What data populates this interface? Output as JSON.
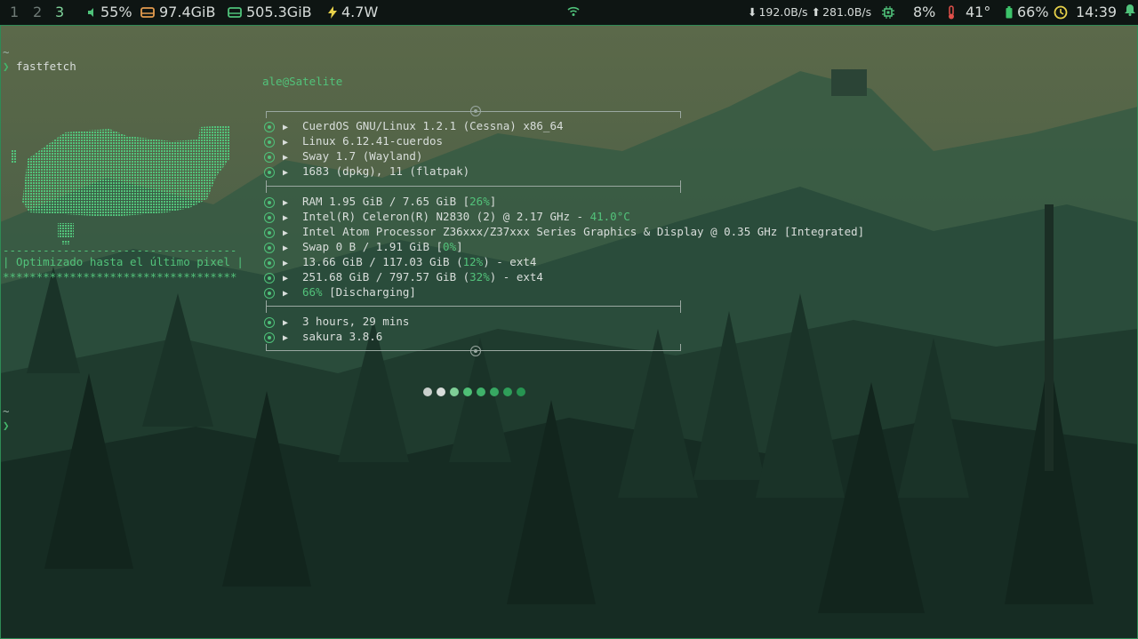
{
  "bar": {
    "workspaces": [
      "1",
      "2",
      "3"
    ],
    "active_workspace": "3",
    "volume": "55%",
    "disk1": "97.4GiB",
    "disk2": "505.3GiB",
    "power": "4.7W",
    "net_down": "192.0B/s",
    "net_up": "281.0B/s",
    "cpu": "8%",
    "temp": "41°",
    "battery": "66%",
    "clock": "14:39",
    "colors": {
      "accent": "#4fc27a",
      "disk1": "#e39b4e",
      "temp": "#e0504a",
      "battery": "#3cc36a",
      "clock": "#e8d24a"
    }
  },
  "terminal": {
    "prompt1_tilde": "~",
    "prompt1_symbol": "❯",
    "command": "fastfetch",
    "prompt2_tilde": "~",
    "prompt2_symbol": "❯",
    "user_host": "ale@Satelite",
    "banner_top": "-----------------------------------",
    "banner_text": "| Optimizado hasta el último pixel |",
    "banner_bottom": "***********************************",
    "groups": [
      [
        {
          "icon": "os-icon",
          "text": "CuerdOS GNU/Linux 1.2.1 (Cessna) x86_64"
        },
        {
          "icon": "kernel-icon",
          "text": "Linux 6.12.41-cuerdos"
        },
        {
          "icon": "wm-icon",
          "text": "Sway 1.7 (Wayland)"
        },
        {
          "icon": "packages-icon",
          "text": "1683 (dpkg), 11 (flatpak)"
        }
      ],
      [
        {
          "icon": "memory-icon",
          "pre": "RAM 1.95 GiB / 7.65 GiB [",
          "hl": "26%",
          "post": "]"
        },
        {
          "icon": "cpu-icon",
          "pre": "Intel(R) Celeron(R) N2830 (2) @ 2.17 GHz - ",
          "hl": "41.0°C",
          "post": ""
        },
        {
          "icon": "gpu-icon",
          "pre": "Intel Atom Processor Z36xxx/Z37xxx Series Graphics & Display @ 0.35 GHz [Integrated]",
          "hl": "",
          "post": ""
        },
        {
          "icon": "swap-icon",
          "pre": "Swap 0 B / 1.91 GiB [",
          "hl": "0%",
          "post": "]"
        },
        {
          "icon": "disk-icon",
          "pre": "13.66 GiB / 117.03 GiB (",
          "hl": "12%",
          "post": ") - ext4"
        },
        {
          "icon": "disk-icon",
          "pre": "251.68 GiB / 797.57 GiB (",
          "hl": "32%",
          "post": ") - ext4"
        },
        {
          "icon": "battery-icon",
          "pre": "",
          "hl": "66%",
          "post": " [Discharging]"
        }
      ],
      [
        {
          "icon": "uptime-icon",
          "text": "3 hours, 29 mins"
        },
        {
          "icon": "terminal-icon",
          "text": "sakura 3.8.6"
        }
      ]
    ],
    "palette": [
      "#c9cfcc",
      "#d8dcda",
      "#7fcf97",
      "#4fbf76",
      "#3fb16a",
      "#37a862",
      "#2f9e59",
      "#269451"
    ]
  }
}
